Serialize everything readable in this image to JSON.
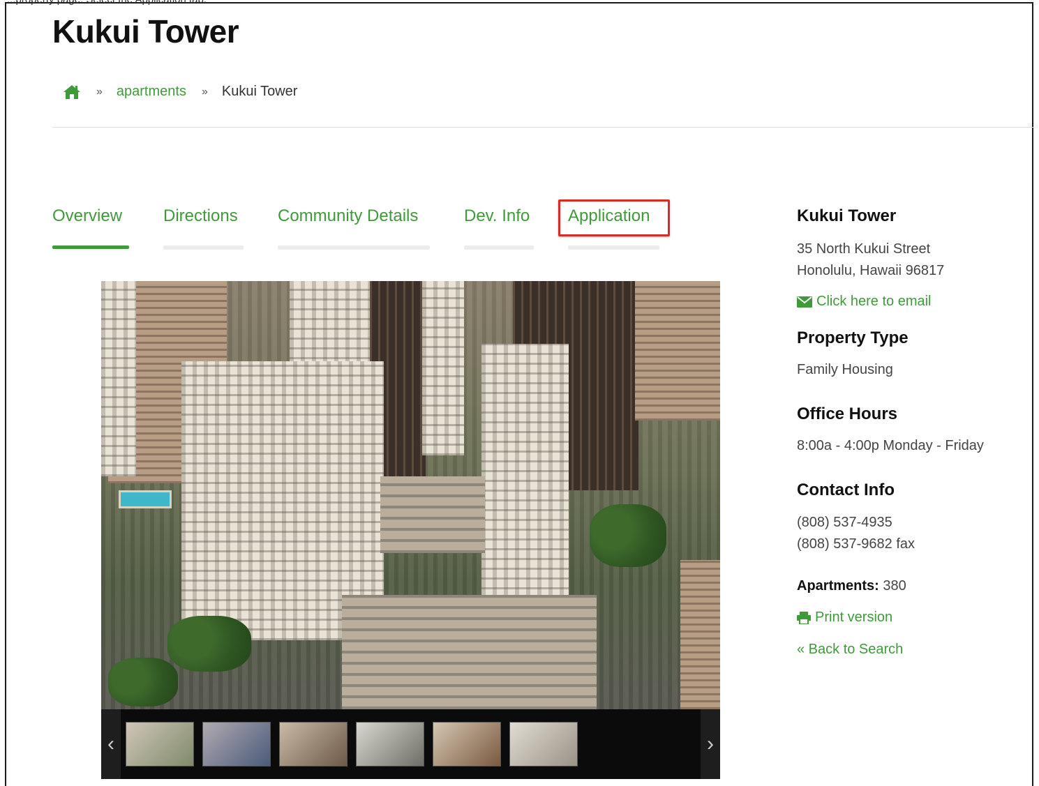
{
  "header": {
    "top_clip": "...property page. Select the Application tab.",
    "title": "Kukui Tower"
  },
  "breadcrumb": {
    "home_icon": "home-icon",
    "sep": "»",
    "apartments": "apartments",
    "current": "Kukui Tower"
  },
  "tabs": [
    {
      "label": "Overview",
      "active": true
    },
    {
      "label": "Directions",
      "active": false
    },
    {
      "label": "Community Details",
      "active": false
    },
    {
      "label": "Dev. Info",
      "active": false
    },
    {
      "label": "Application",
      "active": false,
      "highlighted": true
    }
  ],
  "gallery": {
    "prev_icon": "chevron-left-icon",
    "next_icon": "chevron-right-icon",
    "prev_glyph": "‹",
    "next_glyph": "›",
    "thumb_count": 6
  },
  "sidebar": {
    "name": "Kukui Tower",
    "address_line1": "35 North Kukui Street",
    "address_line2": "Honolulu, Hawaii 96817",
    "email_link": "Click here to email",
    "property_type_heading": "Property Type",
    "property_type": "Family Housing",
    "office_hours_heading": "Office Hours",
    "office_hours": "8:00a - 4:00p Monday - Friday",
    "contact_heading": "Contact Info",
    "phone": "(808) 537-4935",
    "fax": "(808) 537-9682 fax",
    "apartments_label": "Apartments:",
    "apartments_count": "380",
    "print_link": "Print version",
    "back_link": "« Back to Search"
  },
  "colors": {
    "accent_green": "#3f9a3a",
    "highlight_red": "#d62b2b"
  }
}
